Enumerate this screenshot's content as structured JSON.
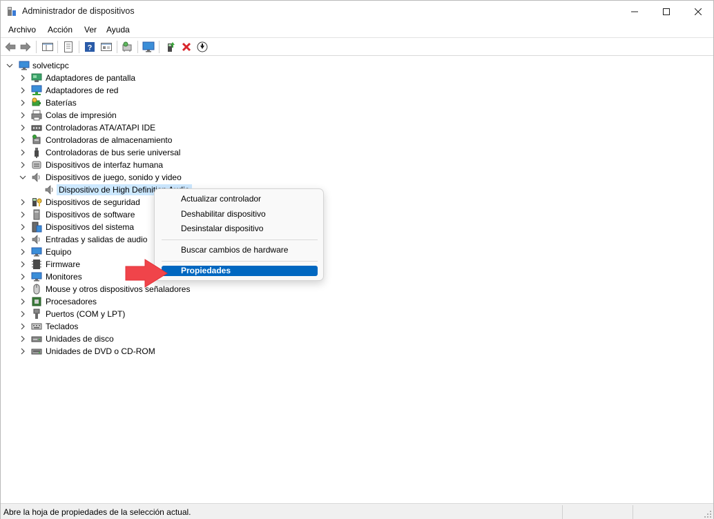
{
  "window": {
    "title": "Administrador de dispositivos"
  },
  "menubar": [
    "Archivo",
    "Acción",
    "Ver",
    "Ayuda"
  ],
  "toolbar": {
    "buttons": [
      "back-icon",
      "forward-icon",
      "show-hide-console-tree-icon",
      "properties-sheet-icon",
      "help-icon",
      "view-icon",
      "scan-hardware-icon",
      "monitor-icon",
      "update-driver-icon",
      "uninstall-icon",
      "disable-device-icon"
    ]
  },
  "tree": {
    "root": "solveticpc",
    "categories": [
      {
        "label": "Adaptadores de pantalla",
        "icon": "display-adapter-icon",
        "expanded": false
      },
      {
        "label": "Adaptadores de red",
        "icon": "network-adapter-icon",
        "expanded": false
      },
      {
        "label": "Baterías",
        "icon": "battery-icon",
        "expanded": false
      },
      {
        "label": "Colas de impresión",
        "icon": "printer-queue-icon",
        "expanded": false
      },
      {
        "label": "Controladoras ATA/ATAPI IDE",
        "icon": "ide-controller-icon",
        "expanded": false
      },
      {
        "label": "Controladoras de almacenamiento",
        "icon": "storage-controller-icon",
        "expanded": false
      },
      {
        "label": "Controladoras de bus serie universal",
        "icon": "usb-icon",
        "expanded": false
      },
      {
        "label": "Dispositivos de interfaz humana",
        "icon": "hid-icon",
        "expanded": false
      },
      {
        "label": "Dispositivos de juego, sonido y video",
        "icon": "speaker-icon",
        "expanded": true,
        "children": [
          {
            "label": "Dispositivo de High Definition Audio",
            "icon": "speaker-icon",
            "selected": true
          }
        ]
      },
      {
        "label": "Dispositivos de seguridad",
        "icon": "security-device-icon",
        "expanded": false
      },
      {
        "label": "Dispositivos de software",
        "icon": "software-device-icon",
        "expanded": false
      },
      {
        "label": "Dispositivos del sistema",
        "icon": "system-device-icon",
        "expanded": false
      },
      {
        "label": "Entradas y salidas de audio",
        "icon": "speaker-icon",
        "expanded": false
      },
      {
        "label": "Equipo",
        "icon": "computer-icon",
        "expanded": false
      },
      {
        "label": "Firmware",
        "icon": "firmware-icon",
        "expanded": false
      },
      {
        "label": "Monitores",
        "icon": "monitor-icon",
        "expanded": false
      },
      {
        "label": "Mouse y otros dispositivos señaladores",
        "icon": "mouse-icon",
        "expanded": false
      },
      {
        "label": "Procesadores",
        "icon": "processor-icon",
        "expanded": false
      },
      {
        "label": "Puertos (COM y LPT)",
        "icon": "port-icon",
        "expanded": false
      },
      {
        "label": "Teclados",
        "icon": "keyboard-icon",
        "expanded": false
      },
      {
        "label": "Unidades de disco",
        "icon": "disk-drive-icon",
        "expanded": false
      },
      {
        "label": "Unidades de DVD o CD-ROM",
        "icon": "dvd-drive-icon",
        "expanded": false
      }
    ]
  },
  "context_menu": {
    "items": [
      {
        "label": "Actualizar controlador"
      },
      {
        "label": "Deshabilitar dispositivo"
      },
      {
        "label": "Desinstalar dispositivo"
      },
      {
        "separator": true
      },
      {
        "label": "Buscar cambios de hardware"
      },
      {
        "separator": true
      },
      {
        "label": "Propiedades",
        "highlighted": true
      }
    ]
  },
  "statusbar": {
    "text": "Abre la hoja de propiedades de la selección actual."
  },
  "colors": {
    "selection": "#cce8ff",
    "menu_highlight": "#0067c0",
    "arrow": "#f0444a"
  }
}
